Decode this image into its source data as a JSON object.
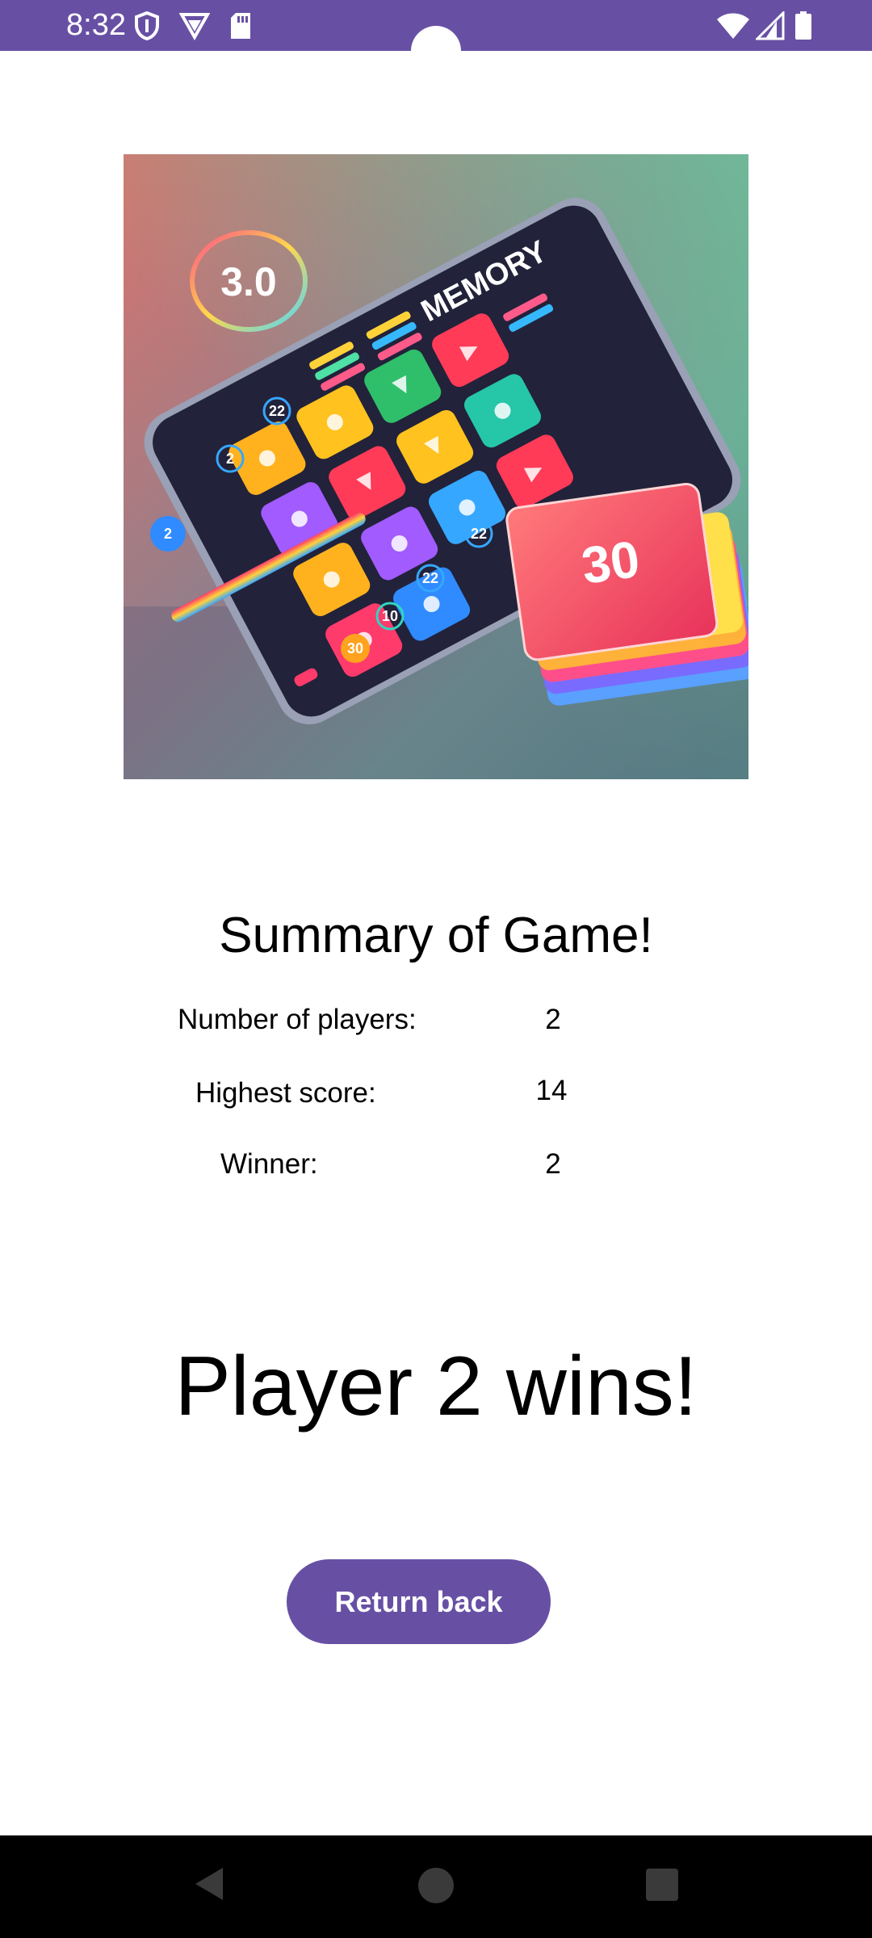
{
  "status_bar": {
    "time": "8:32",
    "icons": [
      "shield-icon",
      "vpn-icon",
      "sd-card-icon",
      "wifi-icon",
      "signal-icon",
      "battery-icon"
    ],
    "color": "#6750A4"
  },
  "hero_image": {
    "alt": "Memory game illustration",
    "phone_title": "MEMORY",
    "timer": "3.0",
    "card_number": "30",
    "small_numbers": [
      "22",
      "2",
      "2",
      "22",
      "22",
      "10",
      "30"
    ]
  },
  "summary": {
    "title": "Summary of Game!",
    "rows": [
      {
        "label": "Number of players:",
        "value": "2"
      },
      {
        "label": "Highest score:",
        "value": "14"
      },
      {
        "label": "Winner:",
        "value": "2"
      }
    ]
  },
  "result_text": "Player 2 wins!",
  "return_button": {
    "label": "Return back",
    "color": "#6750A4"
  },
  "nav_bar": {
    "buttons": [
      "back-icon",
      "home-icon",
      "recents-icon"
    ]
  }
}
